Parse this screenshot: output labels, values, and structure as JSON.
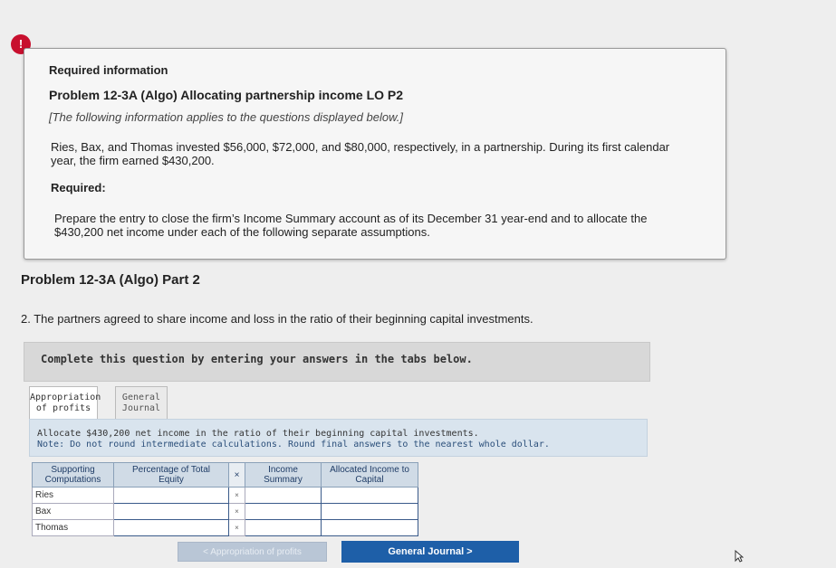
{
  "alert": {
    "symbol": "!"
  },
  "info": {
    "required_label": "Required information",
    "problem_title": "Problem 12-3A (Algo) Allocating partnership income LO P2",
    "note": "[The following information applies to the questions displayed below.]",
    "paragraph1": "Ries, Bax, and Thomas invested $56,000, $72,000, and $80,000, respectively, in a partnership. During its first calendar year, the firm earned $430,200.",
    "required2": "Required:",
    "paragraph2": "Prepare the entry to close the firm’s Income Summary account as of its December 31 year-end and to allocate the $430,200 net income under each of the following separate assumptions."
  },
  "part_title": "Problem 12-3A (Algo) Part 2",
  "question": "2. The partners agreed to share income and loss in the ratio of their beginning capital investments.",
  "complete_bar": "Complete this question by entering your answers in the tabs below.",
  "tabs": [
    {
      "line1": "Appropriation",
      "line2": "of profits"
    },
    {
      "line1": "General",
      "line2": "Journal"
    }
  ],
  "instructions": {
    "line1": "Allocate $430,200 net income in the ratio of their beginning capital investments.",
    "line2": "Note: Do not round intermediate calculations. Round final answers to the nearest whole dollar."
  },
  "table": {
    "headers": {
      "c1a": "Supporting",
      "c1b": "Computations",
      "c2a": "Percentage of Total",
      "c2b": "Equity",
      "c3": "×",
      "c4a": "Income",
      "c4b": "Summary",
      "c5a": "Allocated Income to",
      "c5b": "Capital"
    },
    "rows": [
      {
        "name": "Ries",
        "x": "×"
      },
      {
        "name": "Bax",
        "x": "×"
      },
      {
        "name": "Thomas",
        "x": "×"
      }
    ]
  },
  "nav": {
    "prev_label": "< Appropriation of profits",
    "next_label": "General Journal  >"
  },
  "colors": {
    "accent": "#1e5fa8",
    "alert": "#c8102e"
  }
}
